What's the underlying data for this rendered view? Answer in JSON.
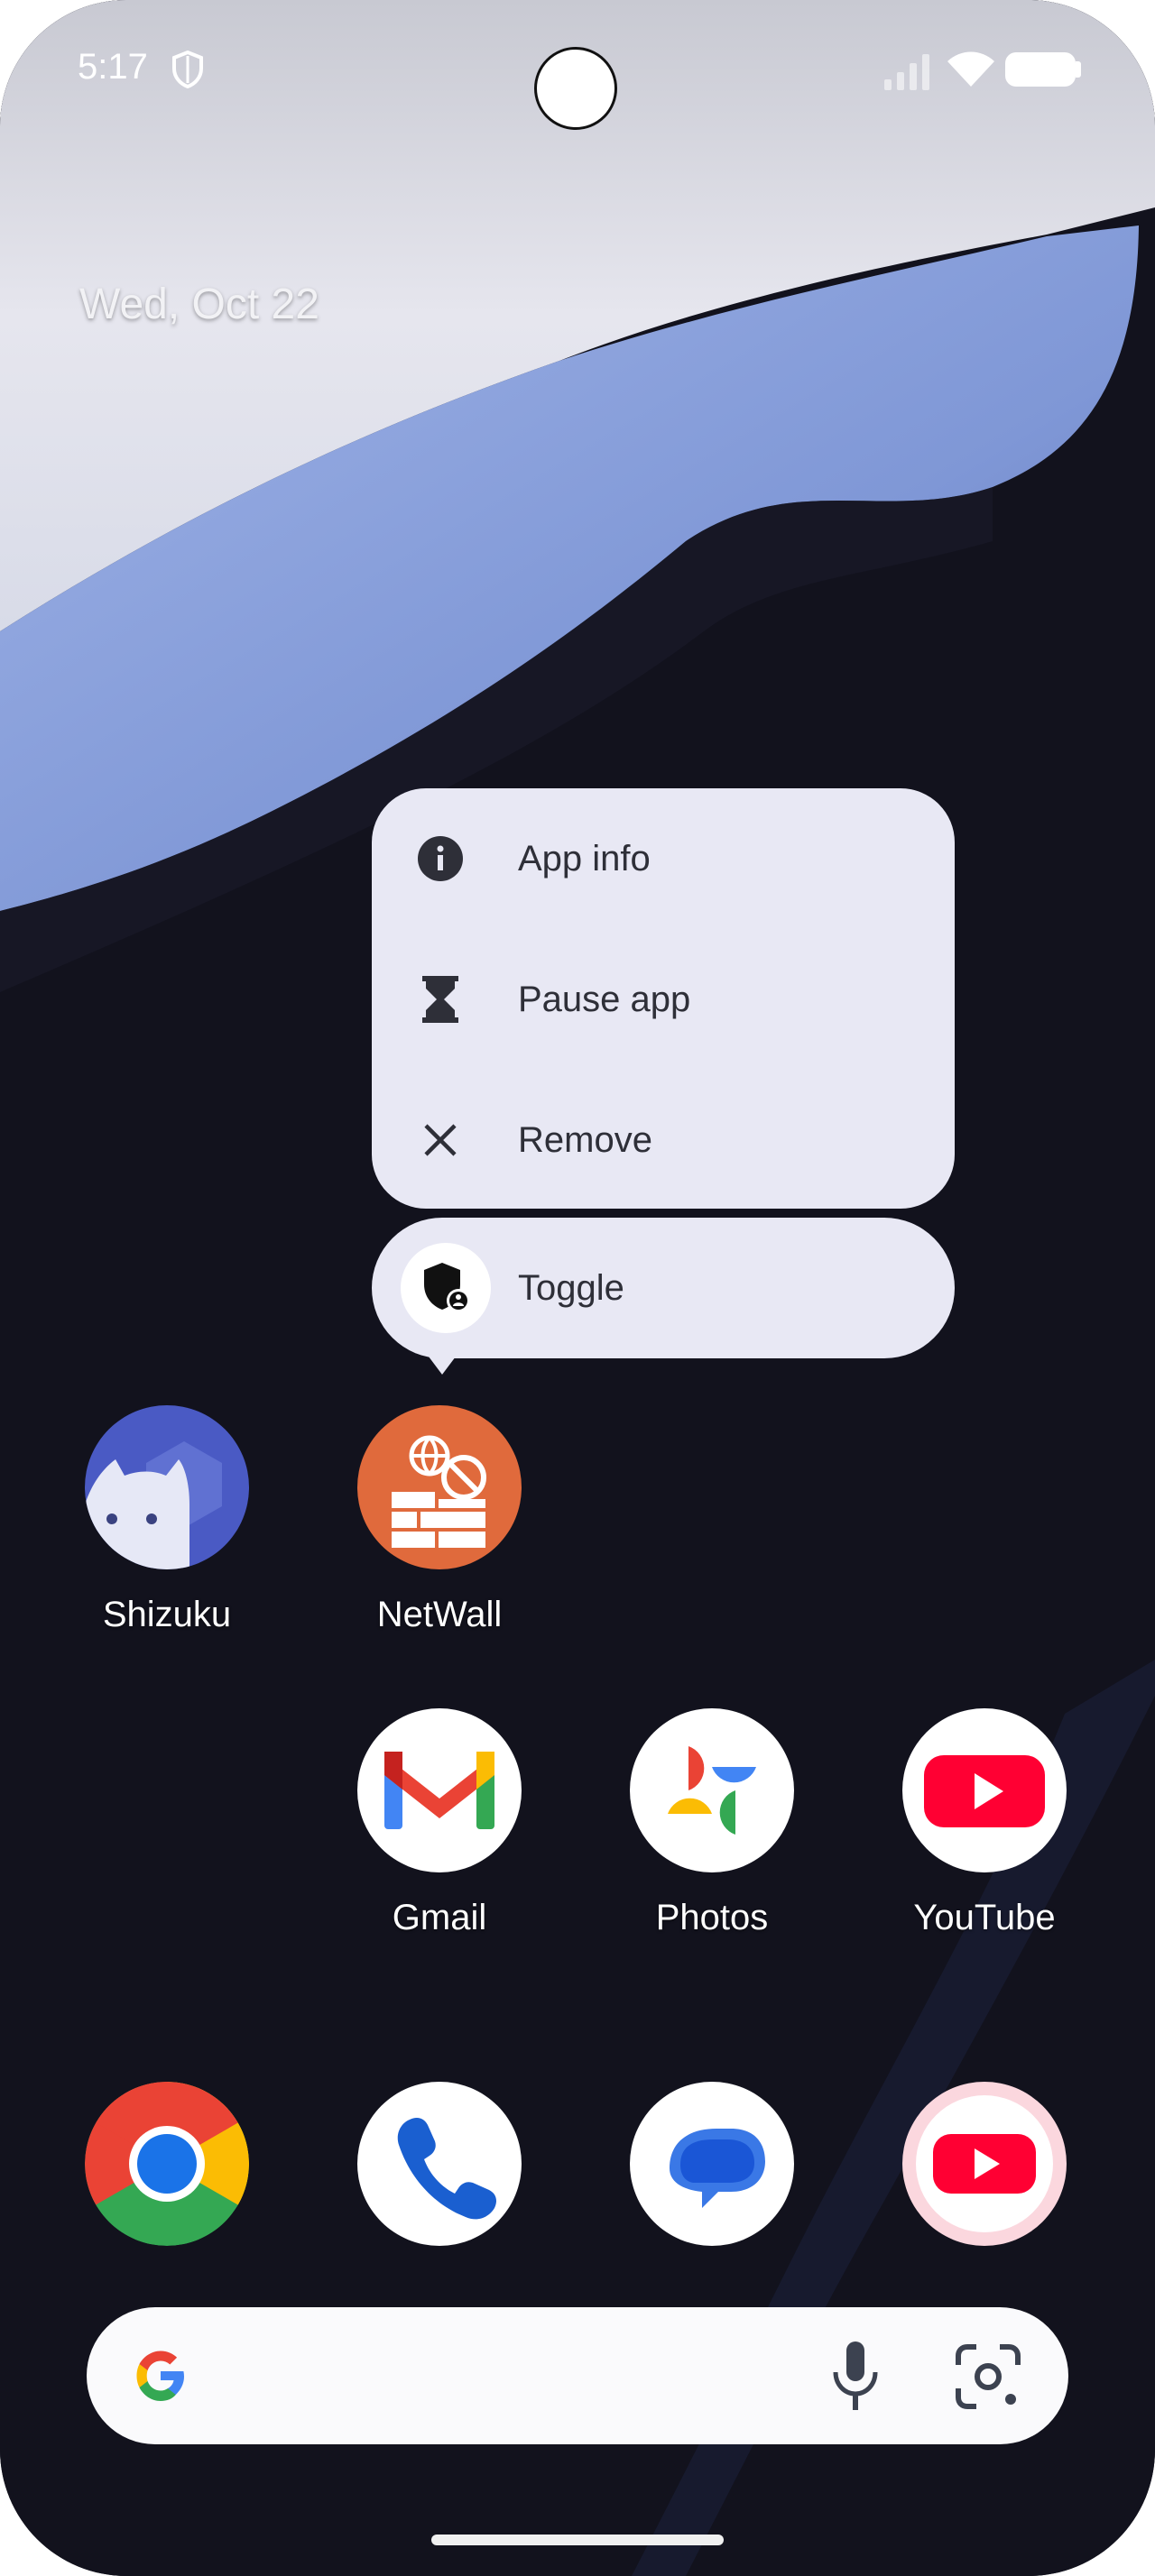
{
  "status_bar": {
    "time": "5:17"
  },
  "home": {
    "date": "Wed, Oct 22"
  },
  "context_menu": {
    "items": [
      {
        "label": "App info",
        "icon": "info-icon"
      },
      {
        "label": "Pause app",
        "icon": "hourglass-icon"
      },
      {
        "label": "Remove",
        "icon": "close-icon"
      }
    ],
    "shortcut": {
      "label": "Toggle",
      "icon": "shield-user-icon"
    }
  },
  "apps": [
    {
      "label": "Shizuku",
      "icon": "shizuku-icon"
    },
    {
      "label": "NetWall",
      "icon": "netwall-firewall-icon"
    },
    {
      "label": "Gmail",
      "icon": "gmail-icon"
    },
    {
      "label": "Photos",
      "icon": "photos-icon"
    },
    {
      "label": "YouTube",
      "icon": "youtube-icon"
    }
  ],
  "dock": [
    "chrome-icon",
    "phone-icon",
    "messages-icon",
    "youtube-music-icon"
  ],
  "search_bar": {
    "icons": [
      "google-g-icon",
      "microphone-icon",
      "lens-camera-icon"
    ]
  },
  "colors": {
    "menu_bg": "#e8e8f4",
    "netwall": "#e06a3c",
    "youtube_red": "#ff0033"
  }
}
